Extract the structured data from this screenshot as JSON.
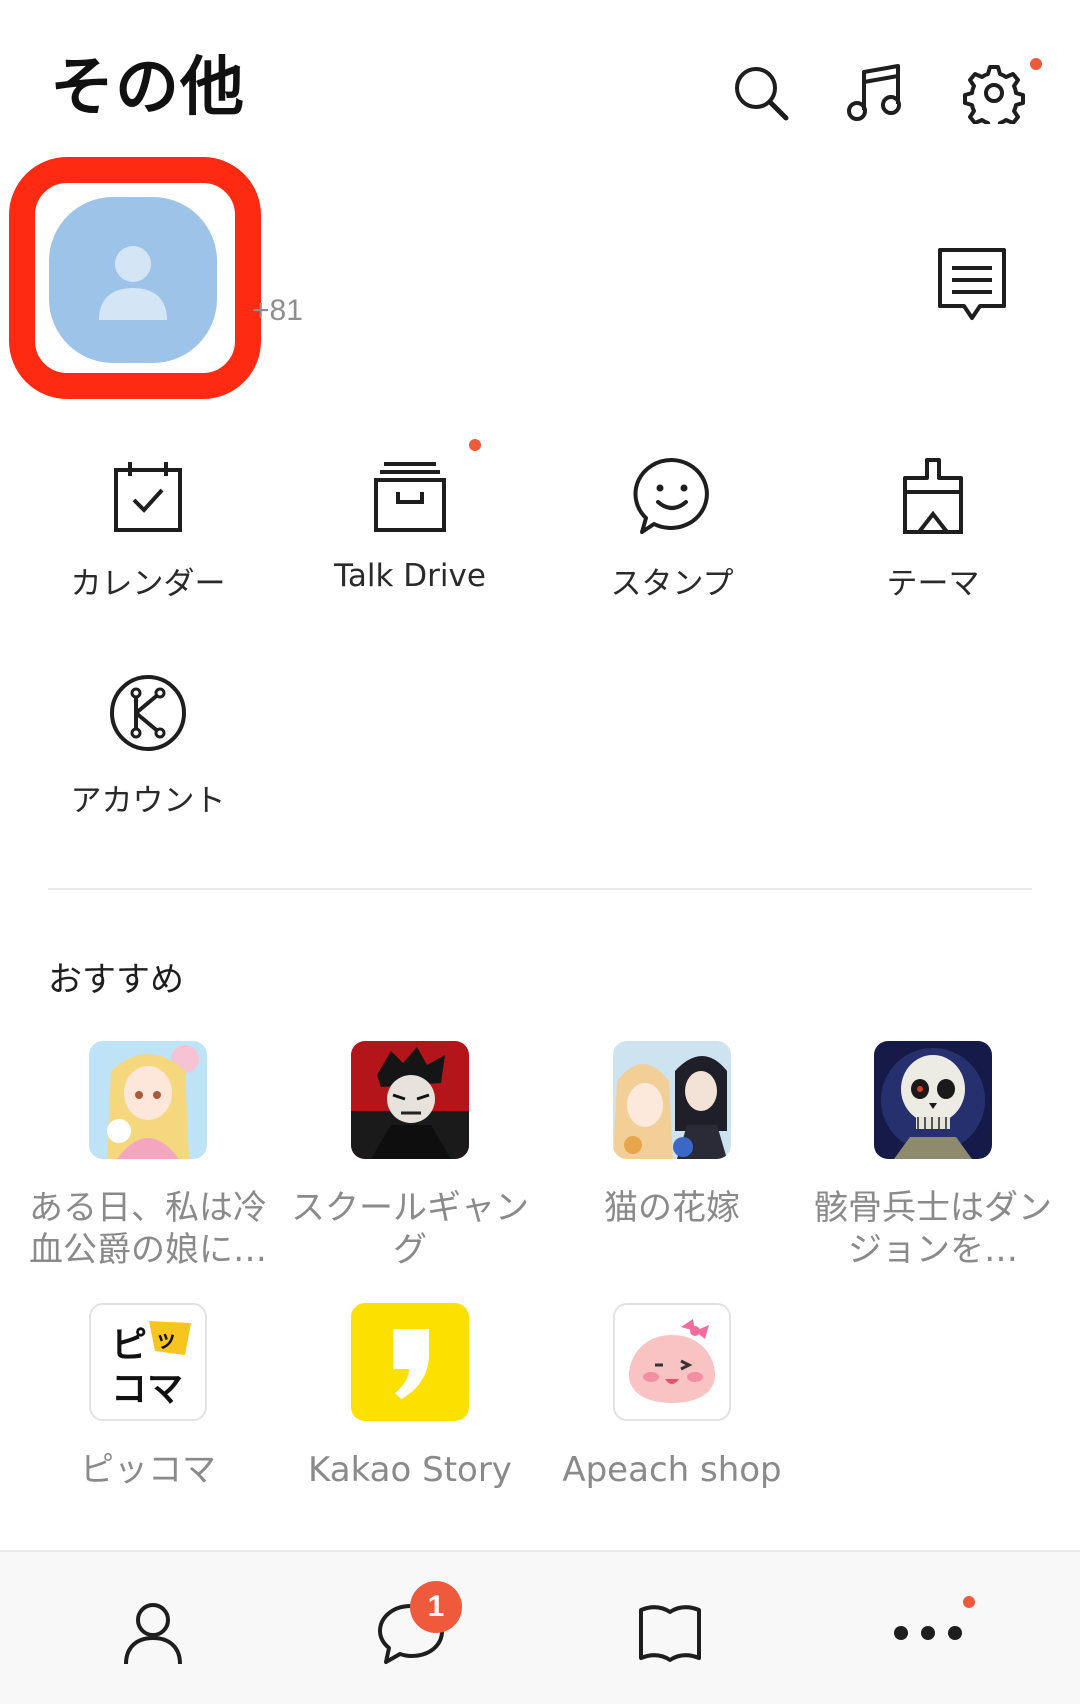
{
  "header": {
    "title": "その他",
    "icons": [
      "search-icon",
      "music-icon",
      "gear-icon"
    ],
    "settings_has_notification": true
  },
  "profile": {
    "phone": "+81",
    "chat_icon": "chat-bubble-icon"
  },
  "quick_menu": [
    {
      "label": "カレンダー",
      "icon": "calendar-icon",
      "has_dot": false
    },
    {
      "label": "Talk Drive",
      "icon": "drive-box-icon",
      "has_dot": true
    },
    {
      "label": "スタンプ",
      "icon": "smile-bubble-icon",
      "has_dot": false
    },
    {
      "label": "テーマ",
      "icon": "paint-brush-icon",
      "has_dot": false
    },
    {
      "label": "アカウント",
      "icon": "kakao-account-icon",
      "has_dot": false
    }
  ],
  "recommendations": {
    "title": "おすすめ",
    "items": [
      {
        "label": "ある日、私は冷血公爵の娘に…"
      },
      {
        "label": "スクールギャング"
      },
      {
        "label": "猫の花嫁"
      },
      {
        "label": "骸骨兵士はダンジョンを…"
      },
      {
        "label": "ピッコマ"
      },
      {
        "label": "Kakao Story"
      },
      {
        "label": "Apeach shop"
      }
    ]
  },
  "bottom_nav": {
    "items": [
      "friends-icon",
      "chats-icon",
      "view-icon",
      "more-icon"
    ],
    "chat_badge": "1"
  },
  "colors": {
    "accent": "#f05a3c",
    "highlight": "#ff2a12",
    "avatar": "#9ec3e8",
    "kakao_story": "#fce100"
  }
}
